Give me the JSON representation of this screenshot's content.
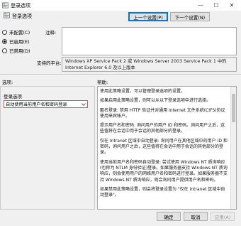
{
  "window": {
    "title": "登录选项",
    "controls": [
      "—",
      "☐",
      "✕"
    ]
  },
  "header": {
    "title": "登录选项",
    "prev_label": "上一个设置(P)",
    "next_label": "下一个设置(N)"
  },
  "state": {
    "options": [
      {
        "label": "未配置(C)",
        "selected": false
      },
      {
        "label": "已启用(E)",
        "selected": true
      },
      {
        "label": "已禁用(D)",
        "selected": false
      }
    ]
  },
  "comment": {
    "label": "注释:",
    "value": ""
  },
  "support": {
    "label": "支持的平台:",
    "value": "Windows XP Service Pack 2 或 Windows Server 2003 Service Pack 1 中的 Internet Explorer 6.0 及以上版本"
  },
  "options_section": {
    "label": "选项:",
    "title": "登录选项",
    "selected_value": "自动使用当前用户名和密码登录"
  },
  "help_section": {
    "label": "帮助:",
    "paragraphs": [
      "使用此策略设置，可以管理登录选项的设置。",
      "如果启用此策略设置，则可以从以下登录选项中进行选择。",
      "匿名登录: 禁用 HTTP 验证并对通用 Internet 文件系统(CIFS)协议使用来宾帐户。",
      "提示用户名和密码: 询问用户的用户 ID 和密码。询问用户之后，这些值将在会话中用于会话的其他部分的登录。",
      "仅在 Intranet 区域中自动登录: 询问用户在其他区域中的用户 ID 和密码，询问用户之后，这些值将在会话中用于会话的其他部分的登录。",
      "使用当前用户名和密码自动登录: 尝试使用 Windows NT 质询响应(也称为 NTLM 身份验证)登录。如果服务器支持 Windows NT 质询响应，则会使用用户的网络用户名和密码进行登录。如果服务器不支持 Windows NT 质询响应，则会询问用户提供用户名和密码。",
      "如果禁用此策略设置，则会将登录设置为 \"仅在 Intranet 区域中自动登录\"。"
    ]
  },
  "footer": {
    "ok_label": "确定",
    "cancel_label": "取消",
    "apply_label": "应用(A)"
  }
}
